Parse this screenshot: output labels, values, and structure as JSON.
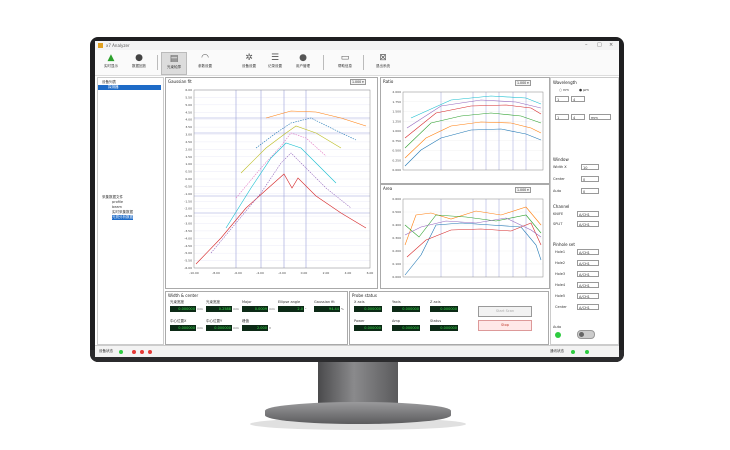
{
  "app": {
    "title": "x7 Analyzer"
  },
  "toolbar": {
    "items": [
      {
        "label": "实时显示",
        "icon": "signal-icon"
      },
      {
        "label": "数据回放",
        "icon": "record-icon"
      },
      {
        "label": "光束轮廓",
        "icon": "profile-icon",
        "active": true
      },
      {
        "label": "参数设置",
        "icon": "wifi-icon"
      },
      {
        "label": "设备设置",
        "icon": "settings-icon"
      },
      {
        "label": "记录设置",
        "icon": "record-list-icon"
      },
      {
        "label": "用户管理",
        "icon": "user-icon"
      },
      {
        "label": "帮助信息",
        "icon": "help-icon"
      },
      {
        "label": "退出系统",
        "icon": "exit-icon"
      }
    ]
  },
  "tree": {
    "top": [
      {
        "label": "设备列表"
      },
      {
        "label": "探测器"
      }
    ],
    "bottom": [
      {
        "label": "采集数据文件"
      },
      {
        "label": "profile"
      },
      {
        "label": "beam"
      },
      {
        "label": "实时采集数据"
      },
      {
        "label": "光斑分析数据"
      }
    ]
  },
  "main_chart": {
    "title": "Gaussian fit",
    "control": "1.000 ▾",
    "y_ticks": [
      "6.00",
      "5.50",
      "5.00",
      "4.50",
      "4.00",
      "3.50",
      "3.00",
      "2.50",
      "2.00",
      "1.50",
      "1.00",
      "0.50",
      "0.00",
      "-0.50",
      "-1.00",
      "-1.50",
      "-2.00",
      "-2.50",
      "-3.00",
      "-3.50",
      "-4.00",
      "-4.50",
      "-5.00",
      "-5.50",
      "-6.00"
    ],
    "x_ticks": [
      "-10.00",
      "-8.00",
      "-6.00",
      "-4.00",
      "-2.00",
      "0.00",
      "2.00",
      "4.00",
      "6.00"
    ]
  },
  "chart_top": {
    "title": "Ratio",
    "control": "1.000 ▾",
    "y_ticks": [
      "2.000",
      "1.750",
      "1.500",
      "1.250",
      "1.000",
      "0.750",
      "0.500",
      "0.250",
      "0.000"
    ]
  },
  "chart_bottom": {
    "title": "Area",
    "control": "1.000 ▾",
    "y_ticks": [
      "0.600",
      "0.500",
      "0.400",
      "0.300",
      "0.200",
      "0.100",
      "0.000"
    ]
  },
  "series_colors": [
    "#1f77b4",
    "#ff7f0e",
    "#2ca02c",
    "#d62728",
    "#9467bd",
    "#17becf",
    "#e377c2",
    "#bcbd22"
  ],
  "beam_panel": {
    "title": "Width & center",
    "fields": [
      {
        "label": "光束宽度",
        "value": "0.000000",
        "unit": "mm"
      },
      {
        "label": "光束宽度",
        "value": "0.2588",
        "unit": "mm"
      },
      {
        "label": "Major",
        "value": "0.0009",
        "unit": "mm"
      },
      {
        "label": "Ellipse angle",
        "value": "2.0",
        "unit": "°"
      },
      {
        "label": "Gaussian fit",
        "value": "94.44",
        "unit": "%"
      },
      {
        "label": "中心位置X",
        "value": "0.000000",
        "unit": "mm"
      },
      {
        "label": "中心位置Y",
        "value": "0.000000",
        "unit": "mm"
      },
      {
        "label": "峰值",
        "value": "2.000",
        "unit": "V"
      }
    ]
  },
  "probe_panel": {
    "title": "Probe status",
    "fields": [
      {
        "label": "X axis",
        "value": "0.000000"
      },
      {
        "label": "Yaxis",
        "value": "0.000000"
      },
      {
        "label": "Z axis",
        "value": "0.000000"
      },
      {
        "label": "Power",
        "value": "0.000000"
      },
      {
        "label": "Amp",
        "value": "0.000000"
      },
      {
        "label": "Status",
        "value": "0.000000"
      }
    ],
    "start_button": "Start Scan",
    "stop_button": "Stop"
  },
  "right_panel": {
    "section1": "Wavelength",
    "radio_a": "nm",
    "radio_b": "μm",
    "spins": [
      "1",
      "4",
      "1",
      "4",
      "mm"
    ],
    "section_window": "Window",
    "window_fields": [
      {
        "label": "Width X",
        "value": "10"
      },
      {
        "label": "Center",
        "value": "0"
      },
      {
        "label": "Auto",
        "value": "0"
      }
    ],
    "section_channel": "Channel",
    "channel_fields": [
      {
        "label": "KNIFE",
        "value": "A/CH1"
      },
      {
        "label": "SPLIT",
        "value": "A/CH1"
      }
    ],
    "section_holes": "Pinhole set",
    "holes": [
      {
        "label": "Hole1",
        "value": "A/CH1"
      },
      {
        "label": "Hole2",
        "value": "A/CH1"
      },
      {
        "label": "Hole3",
        "value": "A/CH1"
      },
      {
        "label": "Hole4",
        "value": "A/CH1"
      },
      {
        "label": "Hole5",
        "value": "A/CH1"
      },
      {
        "label": "Center",
        "value": "A/CH1"
      }
    ],
    "toggle_label": "Auto"
  },
  "status_bar": {
    "left": "设备状态",
    "right": "通讯状态"
  }
}
